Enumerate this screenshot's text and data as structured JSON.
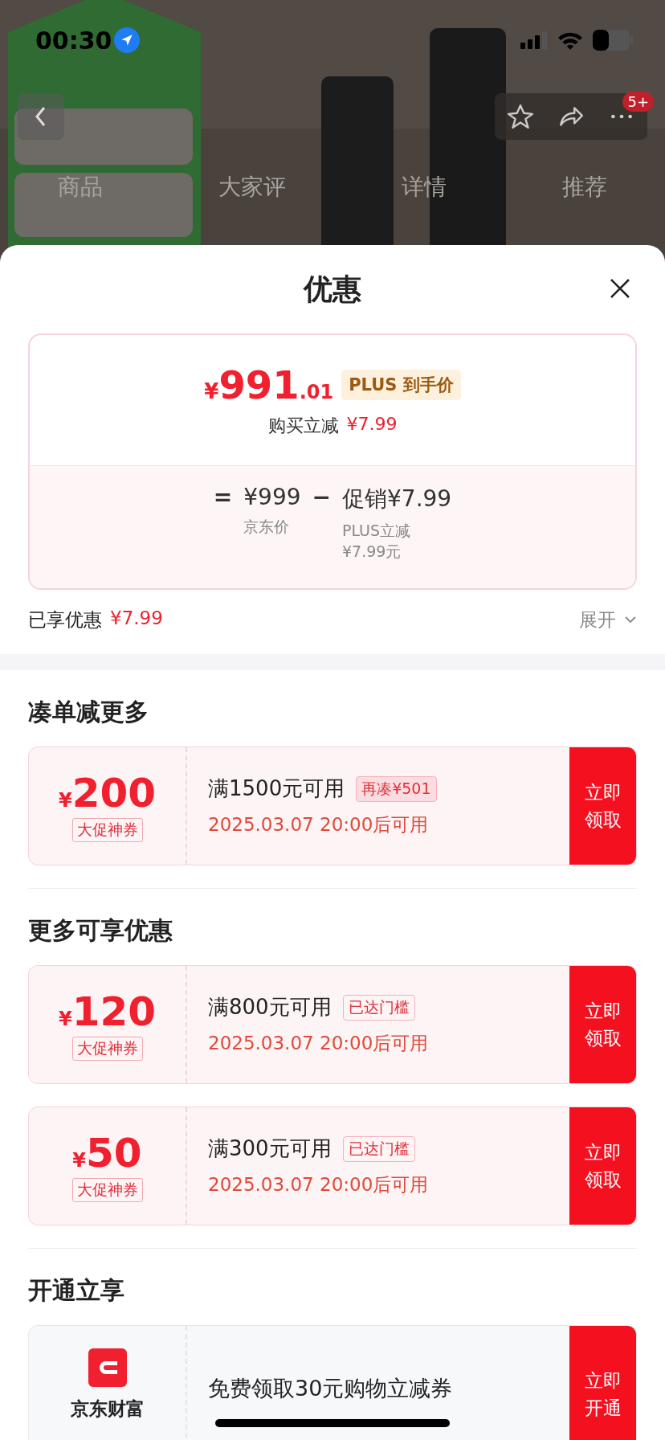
{
  "status_bar": {
    "time": "00:30"
  },
  "nav": {
    "tabs": [
      {
        "label": "商品"
      },
      {
        "label": "大家评"
      },
      {
        "label": "详情"
      },
      {
        "label": "推荐"
      }
    ],
    "badge": "5+"
  },
  "sheet": {
    "title": "优惠"
  },
  "price_card": {
    "currency": "¥",
    "integer": "991",
    "decimal": ".01",
    "tag": "PLUS 到手价",
    "reduce_label": "购买立减",
    "reduce_amount": "¥7.99",
    "terms": [
      {
        "sign": "=",
        "amount": "¥999",
        "note": "京东价"
      },
      {
        "sign": "−",
        "amount": "促销¥7.99",
        "note": "PLUS立减 ¥7.99元"
      }
    ]
  },
  "enjoyed": {
    "label": "已享优惠",
    "amount": "¥7.99",
    "expand": "展开"
  },
  "sections": [
    {
      "title": "凑单减更多",
      "items": [
        {
          "kind": "coupon",
          "currency": "¥",
          "amount": "200",
          "tag": "大促神券",
          "condition": "满1500元可用",
          "badge": "再凑¥501",
          "filled": true,
          "time": "2025.03.07 20:00后可用",
          "button": "立即领取"
        }
      ]
    },
    {
      "title": "更多可享优惠",
      "items": [
        {
          "kind": "coupon",
          "currency": "¥",
          "amount": "120",
          "tag": "大促神券",
          "condition": "满800元可用",
          "badge": "已达门槛",
          "filled": false,
          "time": "2025.03.07 20:00后可用",
          "button": "立即领取"
        },
        {
          "kind": "coupon",
          "currency": "¥",
          "amount": "50",
          "tag": "大促神券",
          "condition": "满300元可用",
          "badge": "已达门槛",
          "filled": false,
          "time": "2025.03.07 20:00后可用",
          "button": "立即领取"
        }
      ]
    },
    {
      "title": "开通立享",
      "items": [
        {
          "kind": "service",
          "brand": "京东财富",
          "text": "免费领取30元购物立减券",
          "button": "立即开通"
        }
      ]
    }
  ]
}
